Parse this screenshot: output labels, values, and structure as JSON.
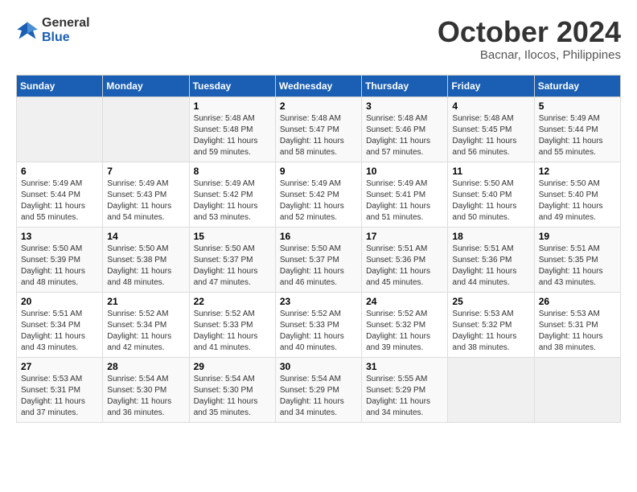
{
  "header": {
    "logo_line1": "General",
    "logo_line2": "Blue",
    "month": "October 2024",
    "location": "Bacnar, Ilocos, Philippines"
  },
  "weekdays": [
    "Sunday",
    "Monday",
    "Tuesday",
    "Wednesday",
    "Thursday",
    "Friday",
    "Saturday"
  ],
  "weeks": [
    [
      {
        "day": "",
        "info": ""
      },
      {
        "day": "",
        "info": ""
      },
      {
        "day": "1",
        "info": "Sunrise: 5:48 AM\nSunset: 5:48 PM\nDaylight: 11 hours\nand 59 minutes."
      },
      {
        "day": "2",
        "info": "Sunrise: 5:48 AM\nSunset: 5:47 PM\nDaylight: 11 hours\nand 58 minutes."
      },
      {
        "day": "3",
        "info": "Sunrise: 5:48 AM\nSunset: 5:46 PM\nDaylight: 11 hours\nand 57 minutes."
      },
      {
        "day": "4",
        "info": "Sunrise: 5:48 AM\nSunset: 5:45 PM\nDaylight: 11 hours\nand 56 minutes."
      },
      {
        "day": "5",
        "info": "Sunrise: 5:49 AM\nSunset: 5:44 PM\nDaylight: 11 hours\nand 55 minutes."
      }
    ],
    [
      {
        "day": "6",
        "info": "Sunrise: 5:49 AM\nSunset: 5:44 PM\nDaylight: 11 hours\nand 55 minutes."
      },
      {
        "day": "7",
        "info": "Sunrise: 5:49 AM\nSunset: 5:43 PM\nDaylight: 11 hours\nand 54 minutes."
      },
      {
        "day": "8",
        "info": "Sunrise: 5:49 AM\nSunset: 5:42 PM\nDaylight: 11 hours\nand 53 minutes."
      },
      {
        "day": "9",
        "info": "Sunrise: 5:49 AM\nSunset: 5:42 PM\nDaylight: 11 hours\nand 52 minutes."
      },
      {
        "day": "10",
        "info": "Sunrise: 5:49 AM\nSunset: 5:41 PM\nDaylight: 11 hours\nand 51 minutes."
      },
      {
        "day": "11",
        "info": "Sunrise: 5:50 AM\nSunset: 5:40 PM\nDaylight: 11 hours\nand 50 minutes."
      },
      {
        "day": "12",
        "info": "Sunrise: 5:50 AM\nSunset: 5:40 PM\nDaylight: 11 hours\nand 49 minutes."
      }
    ],
    [
      {
        "day": "13",
        "info": "Sunrise: 5:50 AM\nSunset: 5:39 PM\nDaylight: 11 hours\nand 48 minutes."
      },
      {
        "day": "14",
        "info": "Sunrise: 5:50 AM\nSunset: 5:38 PM\nDaylight: 11 hours\nand 48 minutes."
      },
      {
        "day": "15",
        "info": "Sunrise: 5:50 AM\nSunset: 5:37 PM\nDaylight: 11 hours\nand 47 minutes."
      },
      {
        "day": "16",
        "info": "Sunrise: 5:50 AM\nSunset: 5:37 PM\nDaylight: 11 hours\nand 46 minutes."
      },
      {
        "day": "17",
        "info": "Sunrise: 5:51 AM\nSunset: 5:36 PM\nDaylight: 11 hours\nand 45 minutes."
      },
      {
        "day": "18",
        "info": "Sunrise: 5:51 AM\nSunset: 5:36 PM\nDaylight: 11 hours\nand 44 minutes."
      },
      {
        "day": "19",
        "info": "Sunrise: 5:51 AM\nSunset: 5:35 PM\nDaylight: 11 hours\nand 43 minutes."
      }
    ],
    [
      {
        "day": "20",
        "info": "Sunrise: 5:51 AM\nSunset: 5:34 PM\nDaylight: 11 hours\nand 43 minutes."
      },
      {
        "day": "21",
        "info": "Sunrise: 5:52 AM\nSunset: 5:34 PM\nDaylight: 11 hours\nand 42 minutes."
      },
      {
        "day": "22",
        "info": "Sunrise: 5:52 AM\nSunset: 5:33 PM\nDaylight: 11 hours\nand 41 minutes."
      },
      {
        "day": "23",
        "info": "Sunrise: 5:52 AM\nSunset: 5:33 PM\nDaylight: 11 hours\nand 40 minutes."
      },
      {
        "day": "24",
        "info": "Sunrise: 5:52 AM\nSunset: 5:32 PM\nDaylight: 11 hours\nand 39 minutes."
      },
      {
        "day": "25",
        "info": "Sunrise: 5:53 AM\nSunset: 5:32 PM\nDaylight: 11 hours\nand 38 minutes."
      },
      {
        "day": "26",
        "info": "Sunrise: 5:53 AM\nSunset: 5:31 PM\nDaylight: 11 hours\nand 38 minutes."
      }
    ],
    [
      {
        "day": "27",
        "info": "Sunrise: 5:53 AM\nSunset: 5:31 PM\nDaylight: 11 hours\nand 37 minutes."
      },
      {
        "day": "28",
        "info": "Sunrise: 5:54 AM\nSunset: 5:30 PM\nDaylight: 11 hours\nand 36 minutes."
      },
      {
        "day": "29",
        "info": "Sunrise: 5:54 AM\nSunset: 5:30 PM\nDaylight: 11 hours\nand 35 minutes."
      },
      {
        "day": "30",
        "info": "Sunrise: 5:54 AM\nSunset: 5:29 PM\nDaylight: 11 hours\nand 34 minutes."
      },
      {
        "day": "31",
        "info": "Sunrise: 5:55 AM\nSunset: 5:29 PM\nDaylight: 11 hours\nand 34 minutes."
      },
      {
        "day": "",
        "info": ""
      },
      {
        "day": "",
        "info": ""
      }
    ]
  ]
}
